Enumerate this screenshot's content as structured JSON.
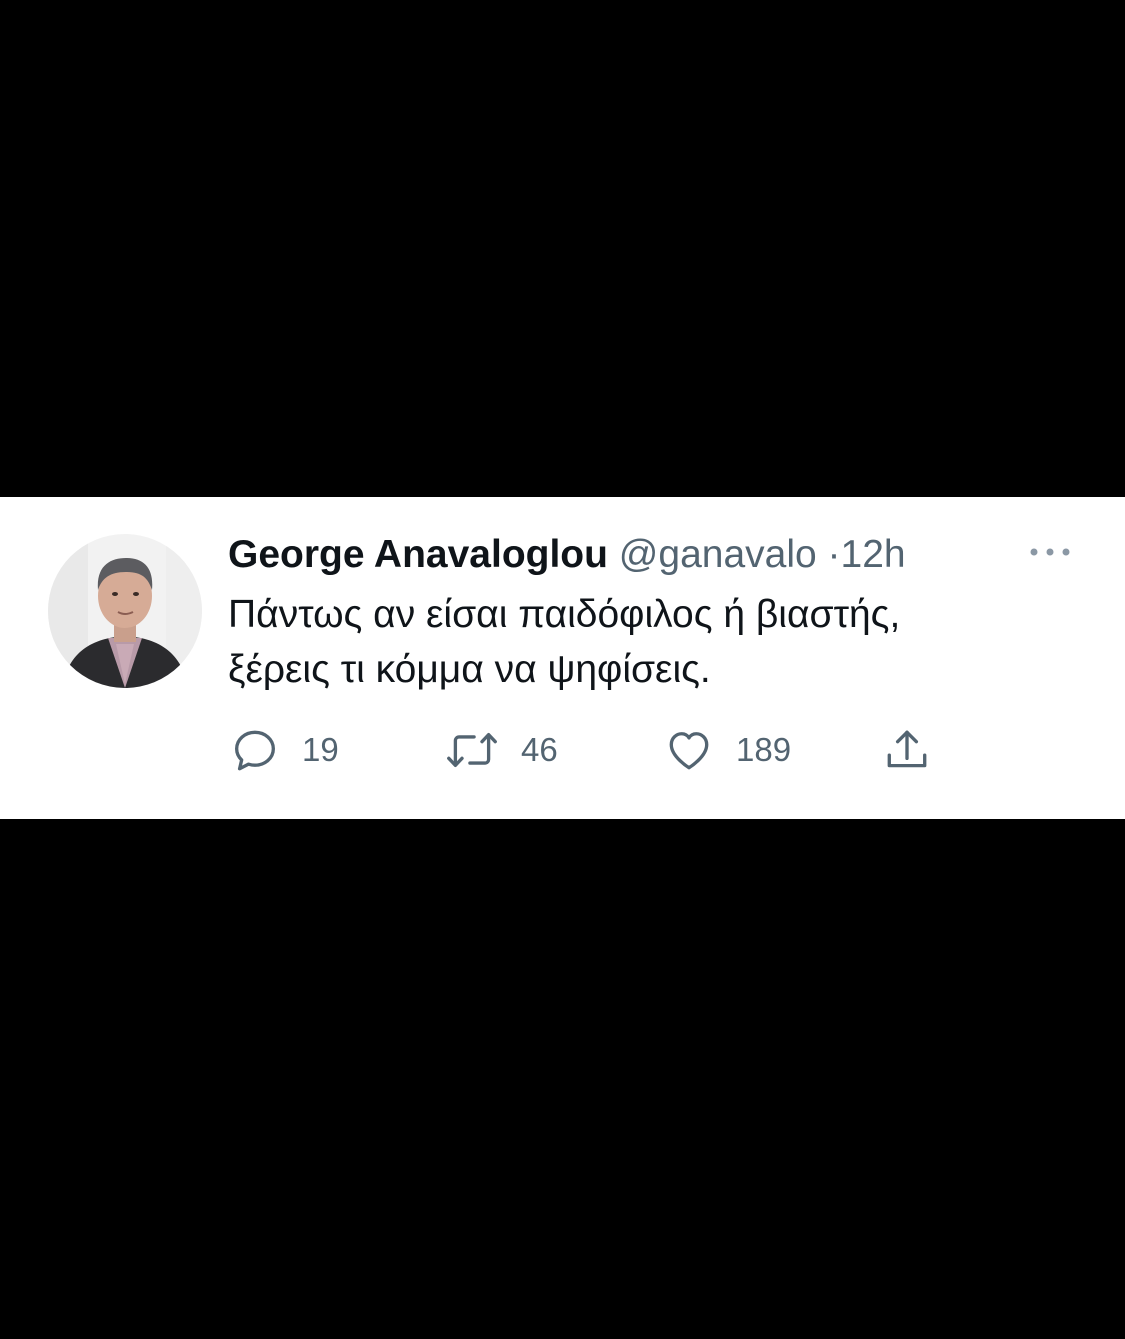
{
  "tweet": {
    "display_name": "George Anavaloglou",
    "handle": "@ganavalo",
    "separator": "·",
    "time": "12h",
    "text_line1": "Πάντως αν είσαι παιδόφιλος ή βιαστής,",
    "text_line2": "ξέρεις τι κόμμα να ψηφίσεις.",
    "avatar_icon": "profile-photo",
    "more_icon": "more-dots-icon"
  },
  "actions": {
    "reply_count": "19",
    "retweet_count": "46",
    "like_count": "189",
    "reply_icon": "reply-icon",
    "retweet_icon": "retweet-icon",
    "like_icon": "heart-icon",
    "share_icon": "share-icon"
  },
  "colors": {
    "background": "#000000",
    "card": "#ffffff",
    "text_primary": "#0f1419",
    "text_secondary": "#536471"
  }
}
